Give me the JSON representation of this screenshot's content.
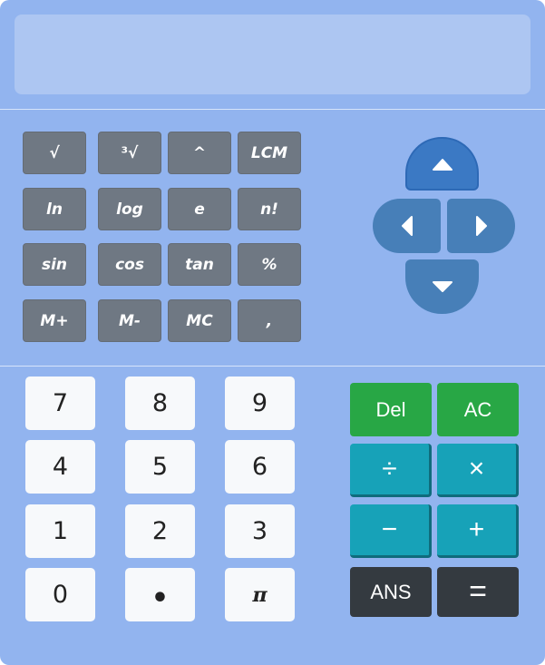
{
  "display": {
    "value": ""
  },
  "scientific_keys": [
    {
      "label": "√"
    },
    {
      "label": "³√"
    },
    {
      "label": "^"
    },
    {
      "label": "LCM"
    },
    {
      "label": "ln"
    },
    {
      "label": "log"
    },
    {
      "label": "e"
    },
    {
      "label": "n!"
    },
    {
      "label": "sin"
    },
    {
      "label": "cos"
    },
    {
      "label": "tan"
    },
    {
      "label": "%"
    },
    {
      "label": "M+"
    },
    {
      "label": "M-"
    },
    {
      "label": "MC"
    },
    {
      "label": ","
    }
  ],
  "arrow_pad": {
    "up_icon": "triangle-up-icon",
    "left_icon": "triangle-left-icon",
    "right_icon": "triangle-right-icon",
    "down_icon": "triangle-down-icon"
  },
  "number_keys": [
    {
      "label": "7"
    },
    {
      "label": "8"
    },
    {
      "label": "9"
    },
    {
      "label": "4"
    },
    {
      "label": "5"
    },
    {
      "label": "6"
    },
    {
      "label": "1"
    },
    {
      "label": "2"
    },
    {
      "label": "3"
    },
    {
      "label": "0"
    },
    {
      "label": "•"
    },
    {
      "label": "π"
    }
  ],
  "function_keys": {
    "del": "Del",
    "ac": "AC",
    "divide": "÷",
    "multiply": "×",
    "subtract": "−",
    "add": "+",
    "ans": "ANS",
    "equals": "="
  },
  "colors": {
    "body": "#92b4ef",
    "display": "#adc6f2",
    "scientific_key": "#6f7883",
    "arrow_pad": "#477fb8",
    "arrow_up_active": "#3b79c4",
    "number_key": "#f7f9fb",
    "green_key": "#28a745",
    "teal_key": "#17a2b8",
    "dark_key": "#343a40"
  }
}
